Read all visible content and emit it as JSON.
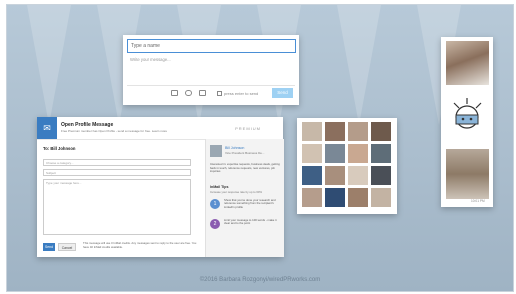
{
  "composer": {
    "name_placeholder": "Type a name",
    "message_placeholder": "Write your message...",
    "enter_label": "press enter to send",
    "send_label": "Send",
    "icons": [
      "image-icon",
      "link-icon",
      "attachment-icon"
    ]
  },
  "open_profile": {
    "title": "Open Profile Message",
    "subtitle": "Free Premium member has Open Profile - send a message for free. Learn more",
    "brand": "PREMIUM",
    "to_label": "To: Bill Johnson",
    "category_placeholder": "Choose a category...",
    "subject_placeholder": "Subject",
    "message_placeholder": "Type your message here...",
    "recipient_name": "Bill Johnson",
    "recipient_title": "Vice President Business De...",
    "recipient_info": "Interested in: expertise requests, business deals, getting back in touch, reference requests, new ventures, job inquiries",
    "tips_title": "InMail Tips",
    "tips_subtitle": "Increase your response rate by up to 60%",
    "tips": [
      {
        "number": "1",
        "text": "Show that you've done your research and reference something from the recipient's LinkedIn profile"
      },
      {
        "number": "2",
        "text": "Limit your message to 100 words - make it clear and to the point"
      }
    ],
    "send_label": "Send",
    "cancel_label": "Cancel",
    "footer_text": "This message will use 0 InMail credits. Any messages sent to reply to the user are free. You have 40 InMail credits available."
  },
  "strip": {
    "timestamp": "10:01 PM"
  },
  "copyright": "©2016 Barbara Rozgonyi/wiredPRworks.com",
  "colors": {
    "accent": "#3a7cc1",
    "send_light": "#9ed1f3",
    "tip1": "#5b8fd0",
    "tip2": "#8a5bb0"
  }
}
